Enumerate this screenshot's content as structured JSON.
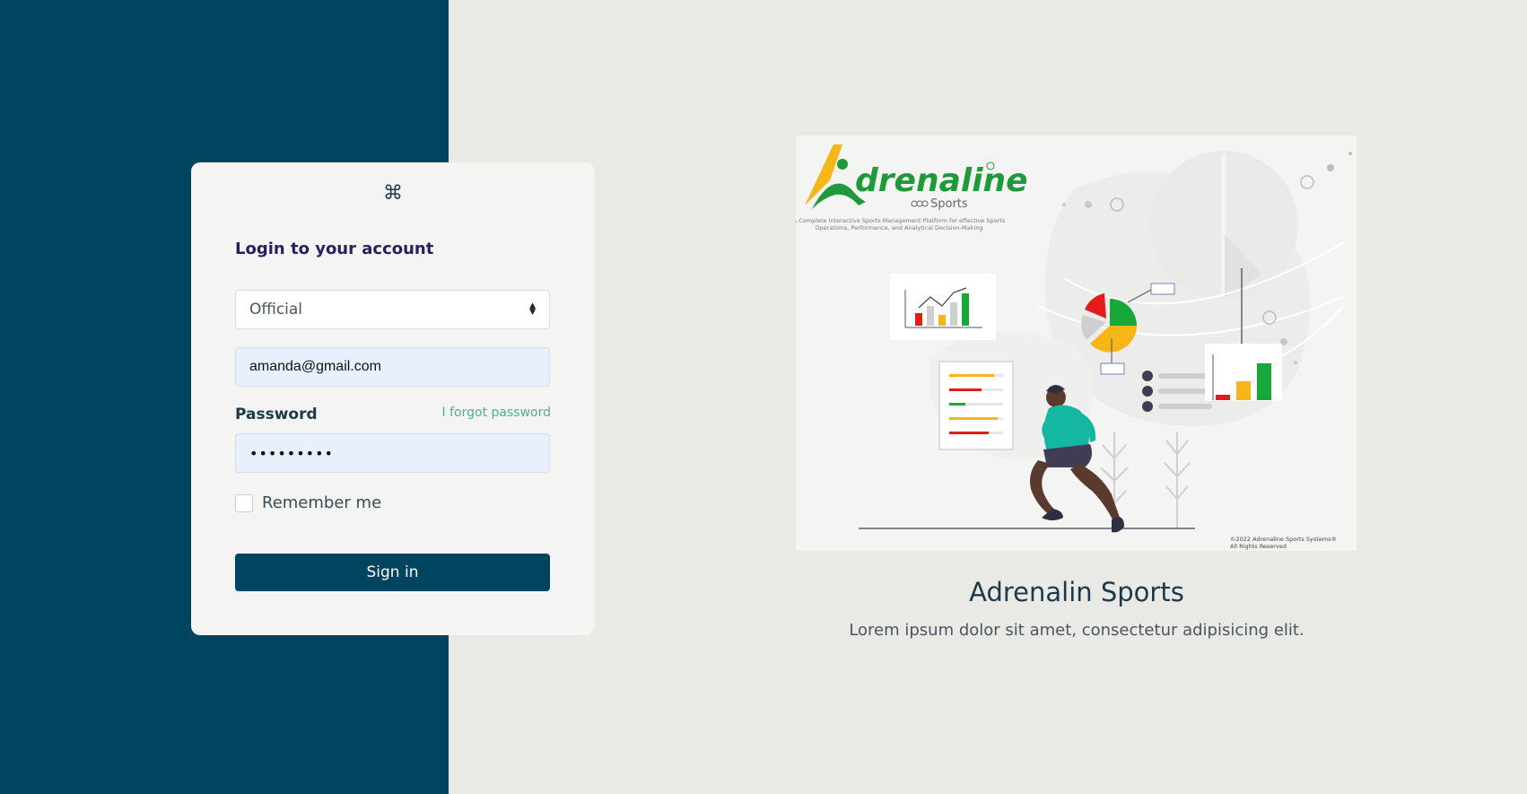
{
  "login": {
    "logo_icon": "⌘",
    "title": "Login to your account",
    "role_select": {
      "selected": "Official"
    },
    "email": {
      "value": "amanda@gmail.com"
    },
    "password_label": "Password",
    "forgot_link": "I forgot password",
    "password": {
      "masked_value": "•••••••••"
    },
    "remember_label": "Remember me",
    "signin_label": "Sign in"
  },
  "hero": {
    "brand_name": "drenaline",
    "brand_sub": "Sports",
    "tagline_line1": "A Complete Interactive Sports Management Platform for effective Sports",
    "tagline_line2": "Operations, Performance, and Analytical Decision-Making",
    "copyright_line1": "©2022 Adrenaline Sports Systems®",
    "copyright_line2": "All Rights Reserved",
    "title": "Adrenalin Sports",
    "subtitle": "Lorem ipsum dolor sit amet, consectetur adipisicing elit."
  },
  "colors": {
    "sidebar_bg": "#004460",
    "accent_green": "#4caf8d",
    "chart_red": "#e31b1b",
    "chart_yellow": "#f6b617",
    "chart_green": "#18a83a"
  }
}
